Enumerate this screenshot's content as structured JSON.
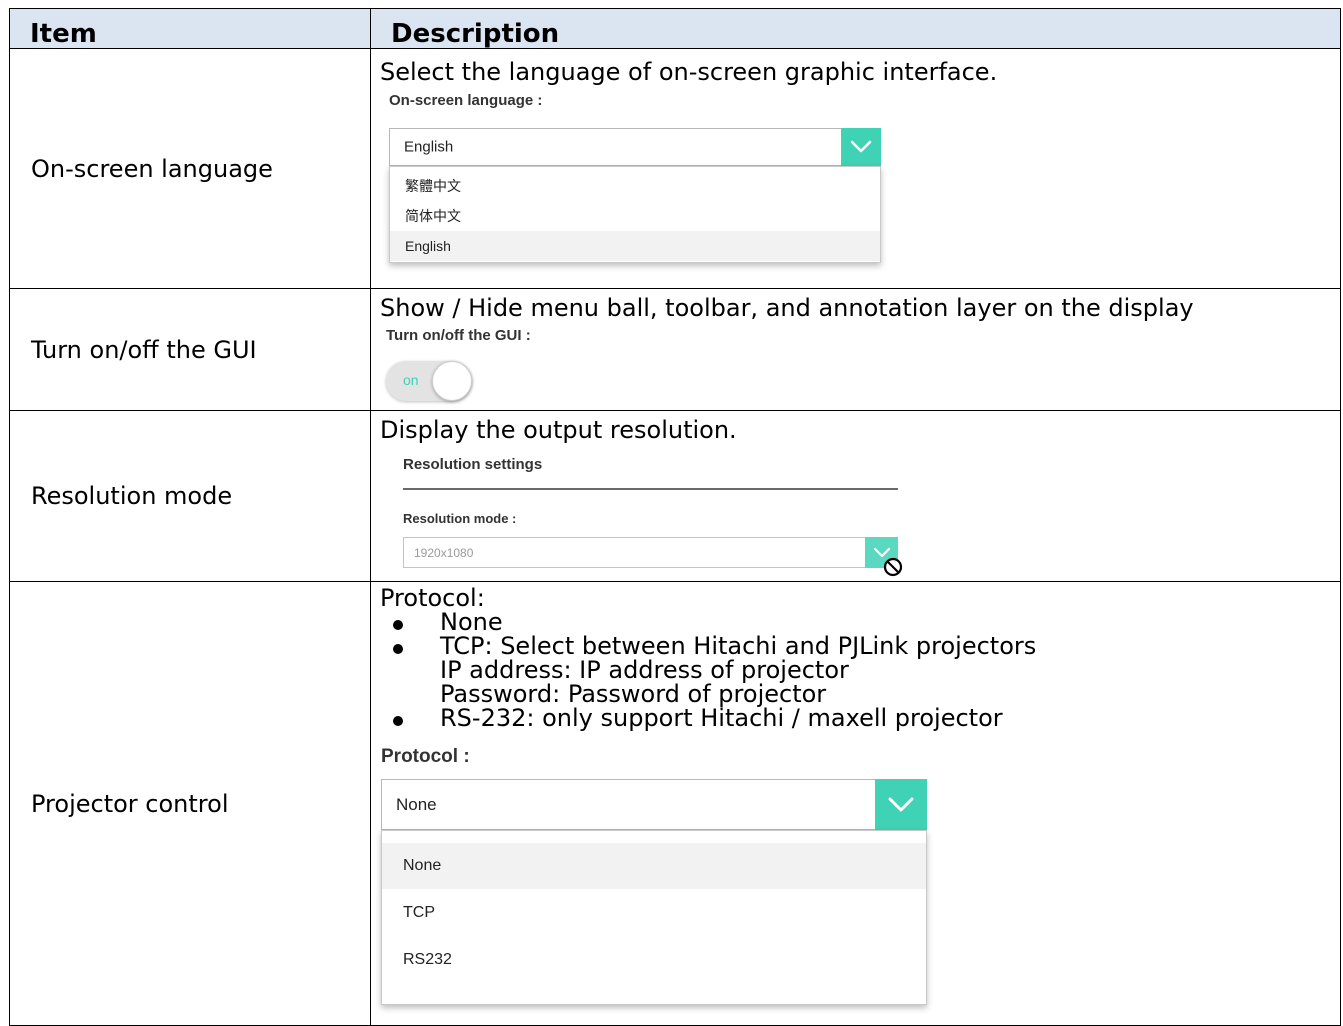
{
  "table": {
    "headers": {
      "item": "Item",
      "description": "Description"
    },
    "rows": [
      {
        "item": "On-screen language",
        "description": "Select the language of on-screen graphic interface.",
        "ui": {
          "label": "On-screen language :",
          "selected": "English",
          "options": [
            "繁體中文",
            "简体中文",
            "English"
          ]
        }
      },
      {
        "item": "Turn on/off the GUI",
        "description": "Show / Hide menu ball, toolbar, and annotation layer on the display",
        "ui": {
          "label": "Turn on/off the GUI :",
          "toggle_text": "on"
        }
      },
      {
        "item": "Resolution mode",
        "description": "Display the output resolution.",
        "ui": {
          "section_title": "Resolution settings",
          "label": "Resolution mode :",
          "value": "1920x1080"
        }
      },
      {
        "item": "Projector control",
        "description_lines": [
          "Protocol:",
          "None",
          "TCP: Select between Hitachi and PJLink projectors",
          "IP address: IP address of projector",
          "Password: Password of projector",
          "RS-232: only support Hitachi / maxell projector"
        ],
        "ui": {
          "label": "Protocol :",
          "selected": "None",
          "options": [
            "None",
            "TCP",
            "RS232"
          ]
        }
      }
    ]
  },
  "colors": {
    "header_bg": "#dbe5f1",
    "accent": "#3fd2b4"
  },
  "icons": {
    "dropdown_arrow": "chevron-down-icon",
    "disabled_cursor": "no-entry-icon"
  }
}
